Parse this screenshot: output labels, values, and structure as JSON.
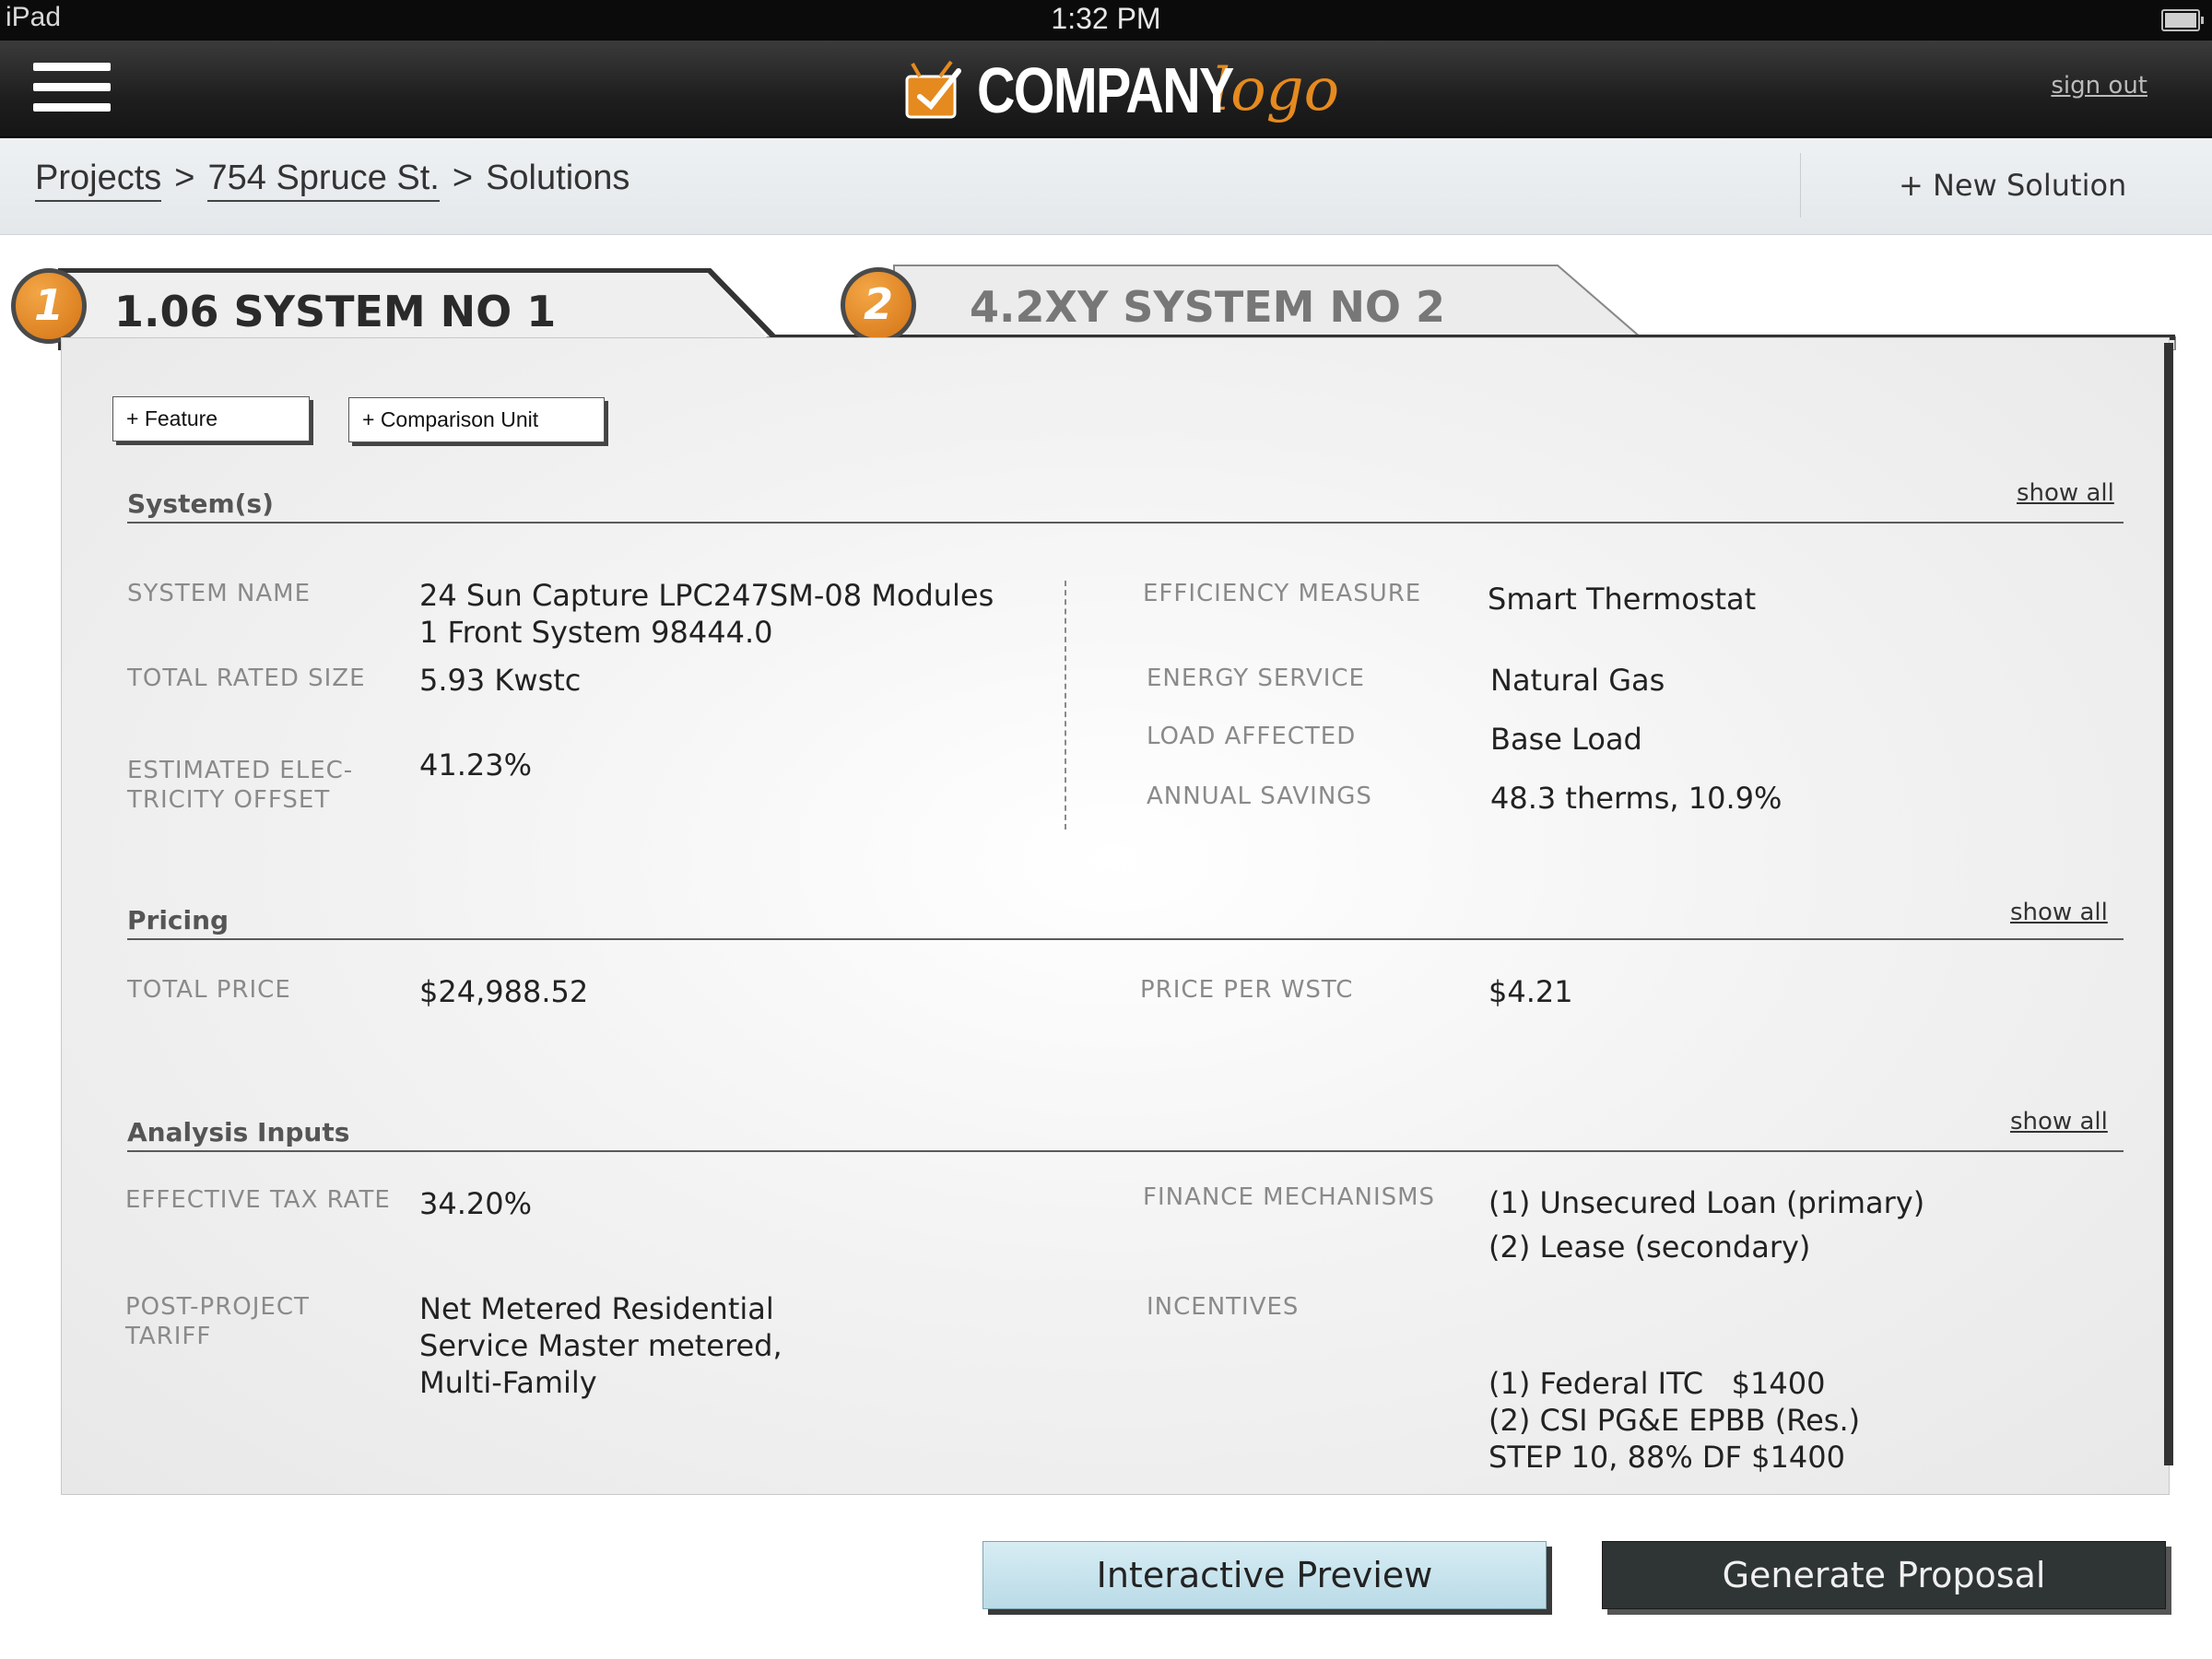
{
  "status_bar": {
    "device": "iPad",
    "time": "1:32 PM"
  },
  "header": {
    "logo_main": "COMPANY",
    "logo_sub": "logo",
    "sign_out": "sign out"
  },
  "breadcrumb": {
    "items": [
      "Projects",
      "754 Spruce St.",
      "Solutions"
    ],
    "separator": ">",
    "new_solution": "+ New Solution"
  },
  "tabs": [
    {
      "number": "1",
      "title": "1.06 SYSTEM NO 1",
      "active": true
    },
    {
      "number": "2",
      "title": "4.2XY SYSTEM NO 2",
      "active": false
    }
  ],
  "actions": {
    "add_feature": "+ Feature",
    "add_comparison": "+ Comparison Unit"
  },
  "systems": {
    "title": "System(s)",
    "show_all": "show all",
    "left": [
      {
        "label": "SYSTEM NAME",
        "value": [
          "24 Sun Capture LPC247SM-08 Modules",
          "1 Front System 98444.0"
        ]
      },
      {
        "label": "TOTAL RATED SIZE",
        "value": [
          "5.93 Kwstc"
        ]
      },
      {
        "label": [
          "ESTIMATED ELEC-",
          "TRICITY OFFSET"
        ],
        "value": [
          "41.23%"
        ]
      }
    ],
    "right": [
      {
        "label": "EFFICIENCY MEASURE",
        "value": "Smart Thermostat"
      },
      {
        "label": "ENERGY SERVICE",
        "value": "Natural Gas"
      },
      {
        "label": "LOAD AFFECTED",
        "value": "Base Load"
      },
      {
        "label": "ANNUAL SAVINGS",
        "value": "48.3 therms, 10.9%"
      }
    ]
  },
  "pricing": {
    "title": "Pricing",
    "show_all": "show all",
    "total_price_label": "TOTAL PRICE",
    "total_price": "$24,988.52",
    "price_per_label": "PRICE PER WSTC",
    "price_per": "$4.21"
  },
  "analysis": {
    "title": "Analysis Inputs",
    "show_all": "show all",
    "tax_label": "EFFECTIVE TAX RATE",
    "tax_value": "34.20%",
    "tariff_label": [
      "POST-PROJECT",
      "TARIFF"
    ],
    "tariff_value": [
      "Net Metered Residential",
      "Service Master metered,",
      "Multi-Family"
    ],
    "finance_label": "FINANCE MECHANISMS",
    "finance_value": [
      "(1) Unsecured Loan (primary)",
      "(2) Lease (secondary)"
    ],
    "incentives_label": "INCENTIVES",
    "incentives_value": [
      "(1) Federal ITC   $1400",
      "(2) CSI PG&E EPBB (Res.)",
      "STEP 10, 88% DF $1400"
    ]
  },
  "footer": {
    "preview": "Interactive Preview",
    "generate": "Generate Proposal"
  },
  "colors": {
    "accent": "#e58a1f",
    "header_bg": "#1e1e1e",
    "button_dark": "#2f3434",
    "button_light": "#c8e4ed"
  }
}
